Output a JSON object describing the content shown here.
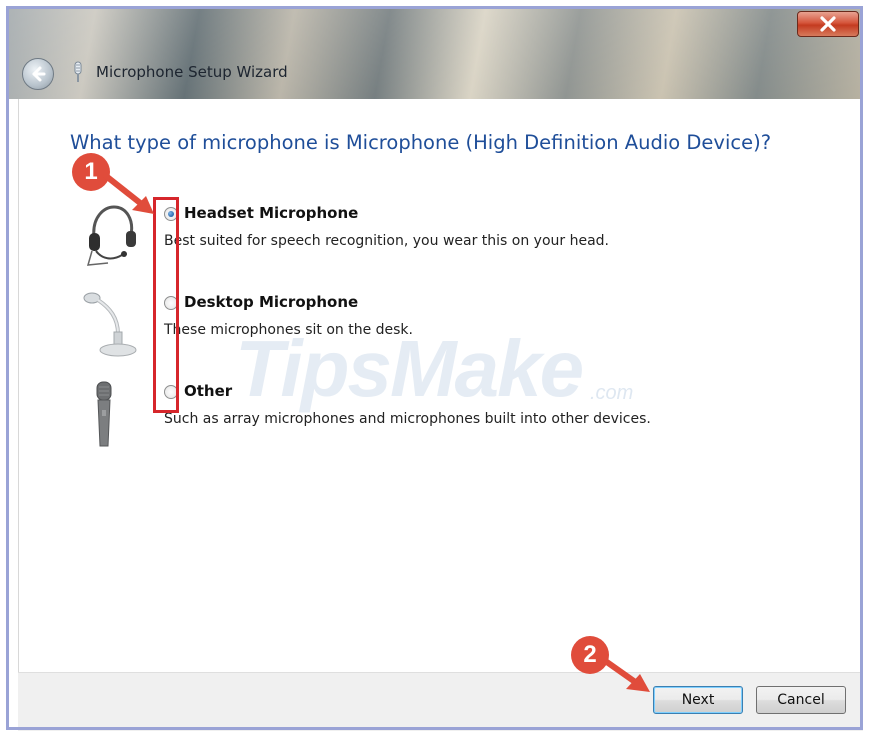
{
  "window": {
    "title": "Microphone Setup Wizard",
    "close_symbol": "x"
  },
  "heading": "What type of microphone is Microphone (High Definition Audio Device)?",
  "options": [
    {
      "label": "Headset Microphone",
      "description": "Best suited for speech recognition, you wear this on your head.",
      "selected": true,
      "icon": "headset-icon"
    },
    {
      "label": "Desktop Microphone",
      "description": "These microphones sit on the desk.",
      "selected": false,
      "icon": "desktop-mic-icon"
    },
    {
      "label": "Other",
      "description": "Such as array microphones and microphones built into other devices.",
      "selected": false,
      "icon": "handheld-mic-icon"
    }
  ],
  "buttons": {
    "next": "Next",
    "cancel": "Cancel"
  },
  "annotations": {
    "step1": "1",
    "step2": "2"
  },
  "watermark": {
    "main": "TipsMake",
    "suffix": ".com"
  },
  "colors": {
    "heading": "#1f4e99",
    "highlight": "#d6262b",
    "badge": "#e04c3b",
    "frame_border": "#9aa3d6"
  }
}
